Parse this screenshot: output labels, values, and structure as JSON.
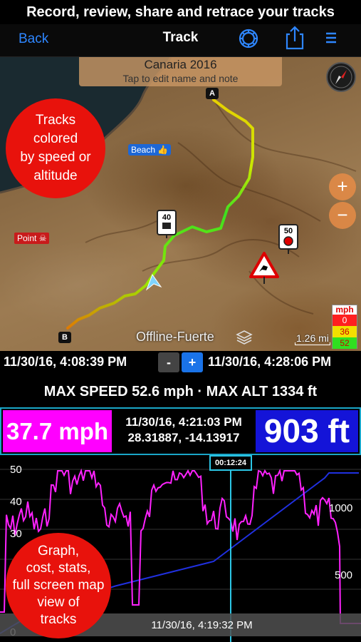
{
  "banner": "Record, review, share and retrace your tracks",
  "nav": {
    "back": "Back",
    "title": "Track",
    "icons": [
      "gear-icon",
      "share-icon",
      "menu-icon"
    ]
  },
  "map": {
    "name": "Canaria 2016",
    "name_hint": "Tap to edit name and note",
    "tracks_bubble": [
      "Tracks",
      "colored",
      "by speed or",
      "altitude"
    ],
    "beach_label": "Beach",
    "point_label": "Point",
    "marker_a": "A",
    "marker_b": "B",
    "speed_sign_1": "40",
    "speed_sign_2": "50",
    "offline_label": "Offline-Fuerte",
    "scale_label": "1.26 mi",
    "legend": {
      "unit": "mph",
      "values": [
        "0",
        "36",
        "52"
      ]
    }
  },
  "time_range": {
    "start": "11/30/16, 4:08:39 PM",
    "minus": "-",
    "plus": "+",
    "end": "11/30/16, 4:28:06 PM"
  },
  "stats": "MAX SPEED 52.6 mph  ·  MAX ALT 1334 ft",
  "readout": {
    "speed": "37.7 mph",
    "time": "11/30/16, 4:21:03 PM",
    "coords": "28.31887, -14.13917",
    "altitude": "903 ft"
  },
  "graph": {
    "cursor_time": "00:12:24",
    "left_ticks": [
      "50",
      "40",
      "30",
      "0"
    ],
    "right_ticks": [
      "1000",
      "500"
    ],
    "bottom_time": "11/30/16, 4:19:32 PM",
    "bubble": [
      "Graph,",
      "cost, stats,",
      "full screen map",
      "view of",
      "tracks"
    ]
  },
  "colors": {
    "accent": "#2e86ff",
    "speed": "#ff00ff",
    "altitude": "#1414d8",
    "bubble": "#e8120c"
  }
}
